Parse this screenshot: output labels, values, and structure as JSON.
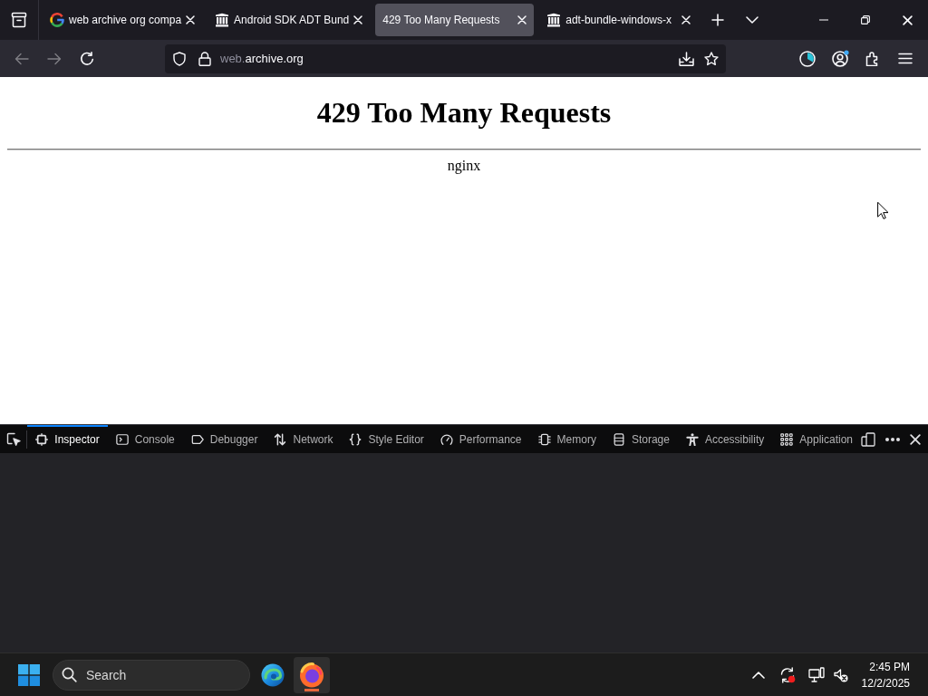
{
  "tab_strip": {
    "tabs": [
      {
        "title": "web archive org compa",
        "kind": "google",
        "selected": false
      },
      {
        "title": "Android SDK ADT Bund",
        "kind": "archive",
        "selected": false
      },
      {
        "title": "429 Too Many Requests",
        "kind": "blank",
        "selected": true
      },
      {
        "title": "adt-bundle-windows-x",
        "kind": "archive",
        "selected": false
      }
    ]
  },
  "navigation": {
    "back": {
      "disabled": true
    },
    "forward": {
      "disabled": true
    },
    "url": {
      "subdomain": "web.",
      "domain": "archive.org"
    }
  },
  "page": {
    "heading": "429 Too Many Requests",
    "server": "nginx"
  },
  "devtools": {
    "tabs": [
      {
        "label": "Inspector",
        "selected": true
      },
      {
        "label": "Console",
        "selected": false
      },
      {
        "label": "Debugger",
        "selected": false
      },
      {
        "label": "Network",
        "selected": false
      },
      {
        "label": "Style Editor",
        "selected": false
      },
      {
        "label": "Performance",
        "selected": false
      },
      {
        "label": "Memory",
        "selected": false
      },
      {
        "label": "Storage",
        "selected": false
      },
      {
        "label": "Accessibility",
        "selected": false
      },
      {
        "label": "Application",
        "selected": false
      }
    ]
  },
  "taskbar": {
    "search": {
      "placeholder": "Search"
    },
    "apps": [
      {
        "kind": "edge",
        "selected": false
      },
      {
        "kind": "firefox",
        "selected": true
      }
    ],
    "clock": {
      "time": "2:45 PM",
      "date": "12/2/2025"
    }
  }
}
